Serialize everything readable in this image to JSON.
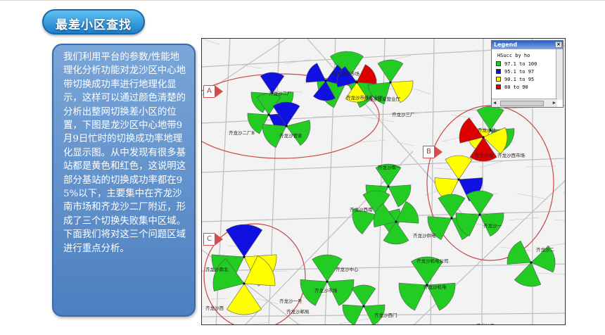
{
  "header": {
    "title": "最差小区查找"
  },
  "description": {
    "text": "我们利用平台的参数/性能地理化分析功能对龙沙区中心地带切换成功率进行地理化显示，这样可以通过颜色清楚的分析出整网切换差小区的位置，下图是龙沙区中心地带9月9日忙时的切换成功率地理化显示图。从中发现有很多基站都是黄色和红色，这说明这部分基站的切换成功率都在95%以下，主要集中在齐龙沙南市场和齐龙沙二厂附近，形成了三个切换失败集中区域。下面我们将对这三个问题区域进行重点分析。"
  },
  "legend": {
    "title": "Legend",
    "close": "×",
    "subtitle": "HSucc by ho",
    "items": [
      {
        "range": "97.1  to  100",
        "color": "#22cc22"
      },
      {
        "range": "95.1  to   97",
        "color": "#1010e0"
      },
      {
        "range": "90.1  to   95",
        "color": "#ffff00"
      },
      {
        "range": "80    to   90",
        "color": "#dd0000"
      }
    ]
  },
  "callouts": {
    "a": "A",
    "b": "B",
    "c": "C"
  },
  "cell_labels": [
    "齐龙沙南市场",
    "齐龙沙二厂",
    "齐龙沙二厂B",
    "齐龙沙管家",
    "齐龙沙市场营业厅",
    "齐龙沙管家营业厅",
    "齐龙沙三厂",
    "齐龙沙北",
    "齐龙沙东",
    "齐龙沙西市场",
    "齐龙沙南一",
    "齐龙沙西南",
    "齐龙沙供电",
    "齐龙沙一",
    "齐龙沙二",
    "齐龙沙机电公司",
    "齐龙沙机电",
    "齐龙沙中心",
    "齐龙沙市场",
    "齐龙沙南北",
    "齐龙沙西",
    "齐龙沙一号",
    "齐龙沙邮局",
    "齐龙沙三",
    "齐龙沙西门"
  ],
  "colors": {
    "green": "#22cc22",
    "blue": "#1010e0",
    "yellow": "#ffff00",
    "red": "#dd0000",
    "circle": "#c84848"
  }
}
